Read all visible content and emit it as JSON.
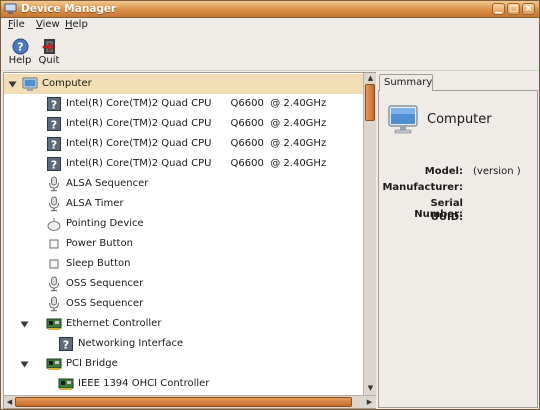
{
  "window": {
    "title": "Device Manager"
  },
  "menu": {
    "file": "File",
    "view": "View",
    "help": "Help"
  },
  "toolbar": {
    "help_label": "Help",
    "quit_label": "Quit"
  },
  "tree": [
    {
      "label": "Computer",
      "icon": "monitor-icon",
      "expander": "expanded",
      "selected": true
    },
    {
      "label": "Intel(R) Core(TM)2 Quad CPU      Q6600  @ 2.40GHz",
      "icon": "unknown-device-icon"
    },
    {
      "label": "Intel(R) Core(TM)2 Quad CPU      Q6600  @ 2.40GHz",
      "icon": "unknown-device-icon"
    },
    {
      "label": "Intel(R) Core(TM)2 Quad CPU      Q6600  @ 2.40GHz",
      "icon": "unknown-device-icon"
    },
    {
      "label": "Intel(R) Core(TM)2 Quad CPU      Q6600  @ 2.40GHz",
      "icon": "unknown-device-icon"
    },
    {
      "label": "ALSA Sequencer",
      "icon": "microphone-icon"
    },
    {
      "label": "ALSA Timer",
      "icon": "microphone-icon"
    },
    {
      "label": "Pointing Device",
      "icon": "mouse-icon"
    },
    {
      "label": "Power Button",
      "icon": "button-icon"
    },
    {
      "label": "Sleep Button",
      "icon": "button-icon"
    },
    {
      "label": "OSS Sequencer",
      "icon": "microphone-icon"
    },
    {
      "label": "OSS Sequencer",
      "icon": "microphone-icon"
    },
    {
      "label": "Ethernet Controller",
      "icon": "network-card-icon",
      "expander": "expanded"
    },
    {
      "label": "Networking Interface",
      "icon": "unknown-device-icon"
    },
    {
      "label": "PCI Bridge",
      "icon": "network-card-icon",
      "expander": "expanded"
    },
    {
      "label": "IEEE 1394 OHCI Controller",
      "icon": "network-card-icon"
    }
  ],
  "summary": {
    "tab_label": "Summary",
    "device_name": "Computer",
    "model_label": "Model:",
    "model_value": "(version )",
    "manufacturer_label": "Manufacturer:",
    "manufacturer_value": "",
    "serial_label": "Serial Number:",
    "serial_value": "",
    "uuid_label": "UUID:",
    "uuid_value": ""
  },
  "colors": {
    "titlebar": "#d98e48",
    "selection": "#f3ddb5",
    "scroll_thumb": "#d97a38"
  }
}
